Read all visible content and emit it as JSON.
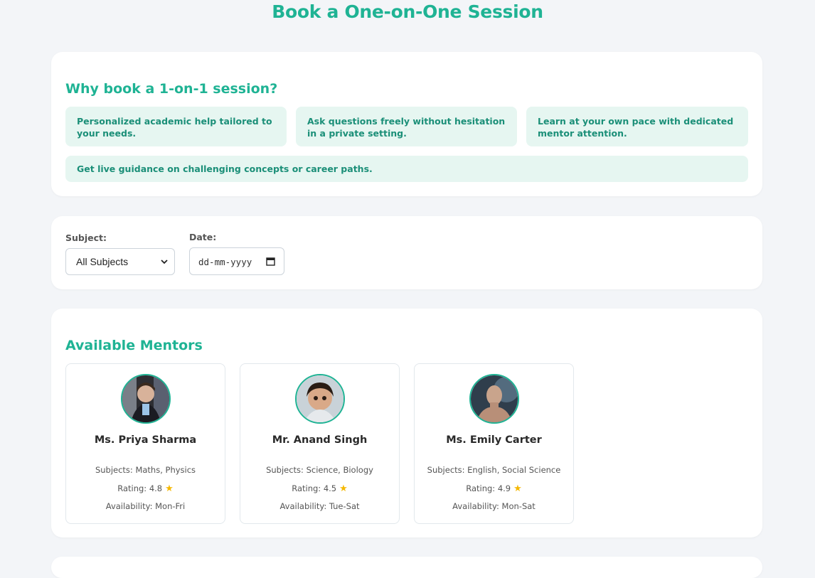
{
  "page": {
    "title": "Book a One-on-One Session"
  },
  "why": {
    "title": "Why book a 1-on-1 session?",
    "benefits": [
      "Personalized academic help tailored to your needs.",
      "Ask questions freely without hesitation in a private setting.",
      "Learn at your own pace with dedicated mentor attention.",
      "Get live guidance on challenging concepts or career paths."
    ]
  },
  "filters": {
    "subject_label": "Subject:",
    "subject_value": "All Subjects",
    "date_label": "Date:",
    "date_placeholder": "dd-mm-yyyy"
  },
  "mentors": {
    "title": "Available Mentors",
    "items": [
      {
        "name": "Ms. Priya Sharma",
        "subjects": "Subjects: Maths, Physics",
        "rating": "Rating: 4.8",
        "availability": "Availability: Mon-Fri"
      },
      {
        "name": "Mr. Anand Singh",
        "subjects": "Subjects: Science, Biology",
        "rating": "Rating: 4.5",
        "availability": "Availability: Tue-Sat"
      },
      {
        "name": "Ms. Emily Carter",
        "subjects": "Subjects: English, Social Science",
        "rating": "Rating: 4.9",
        "availability": "Availability: Mon-Sat"
      }
    ]
  },
  "colors": {
    "accent": "#1fb394",
    "benefit_bg": "#e6f6f1",
    "star": "#f5b800"
  },
  "icons": {
    "star": "star-icon",
    "select_chevron": "chevron-down-icon",
    "date": "calendar-icon"
  }
}
